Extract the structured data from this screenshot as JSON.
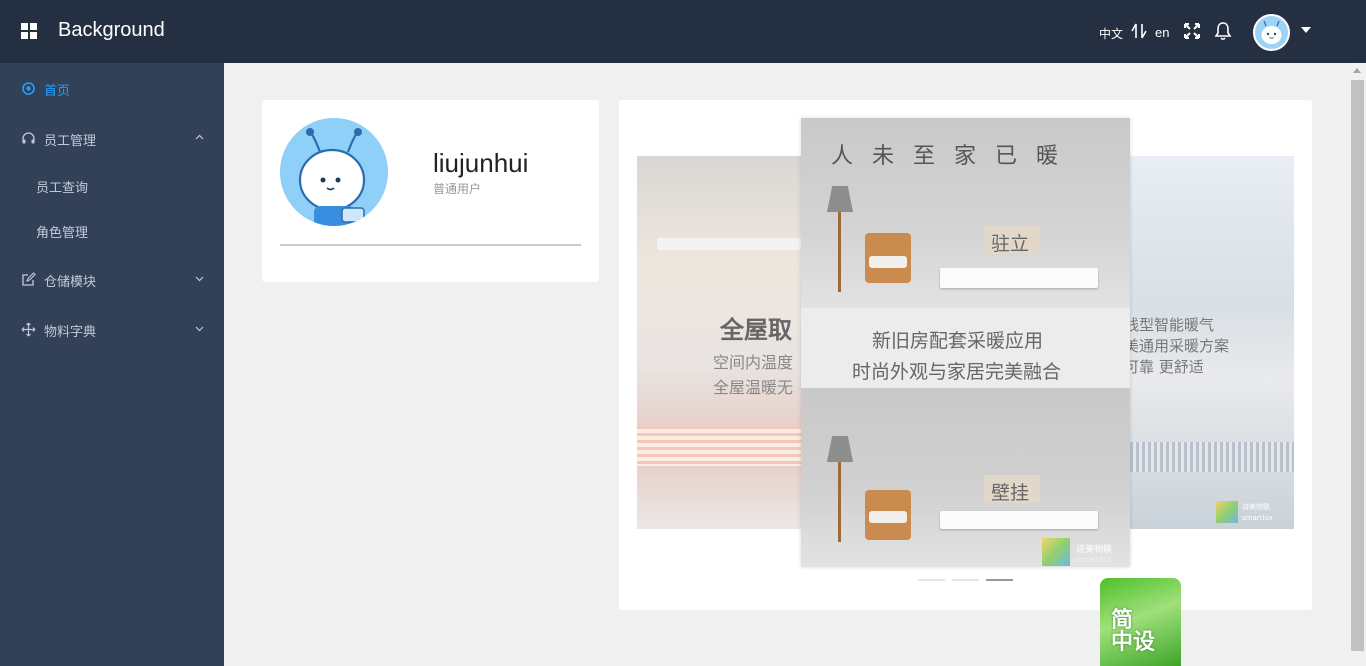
{
  "header": {
    "title": "Background",
    "lang_zh": "中文",
    "lang_en": "en",
    "icons": [
      "grid-icon",
      "language-switch-icon",
      "fullscreen-icon",
      "bell-icon",
      "avatar",
      "caret-down-icon"
    ]
  },
  "sidebar": {
    "items": [
      {
        "label": "首页",
        "icon": "home-icon",
        "active": true
      },
      {
        "label": "员工管理",
        "icon": "headset-icon",
        "expanded": true
      },
      {
        "label": "员工查询"
      },
      {
        "label": "角色管理"
      },
      {
        "label": "仓储模块",
        "icon": "edit-icon",
        "expanded": false
      },
      {
        "label": "物料字典",
        "icon": "move-icon",
        "expanded": false
      }
    ]
  },
  "user_card": {
    "username": "liujunhui",
    "role": "普通用户"
  },
  "carousel": {
    "left_slide": {
      "title": "全屋取",
      "line1": "空间内温度",
      "line2": "全屋温暖无"
    },
    "center_slide": {
      "headline": "人 未 至    家 已 暖",
      "tag_top": "驻立",
      "line1": "新旧房配套采暖应用",
      "line2": "时尚外观与家居完美融合",
      "tag_bottom": "壁挂",
      "brand_cn": "诗美物联",
      "brand_en": "smartlux"
    },
    "right_slide": {
      "line1": "线型智能暖气",
      "line2": "美通用采暖方案",
      "line3": "可靠 更舒适",
      "brand_cn": "诗美物联",
      "brand_en": "smartlux"
    },
    "active_index": 2,
    "dot_count": 3
  },
  "badge": {
    "line1": "简",
    "line2": "中设"
  },
  "colors": {
    "header_bg": "#242f42",
    "sidebar_bg": "#324157",
    "accent": "#20a0ff",
    "content_bg": "#f0f0f0"
  }
}
